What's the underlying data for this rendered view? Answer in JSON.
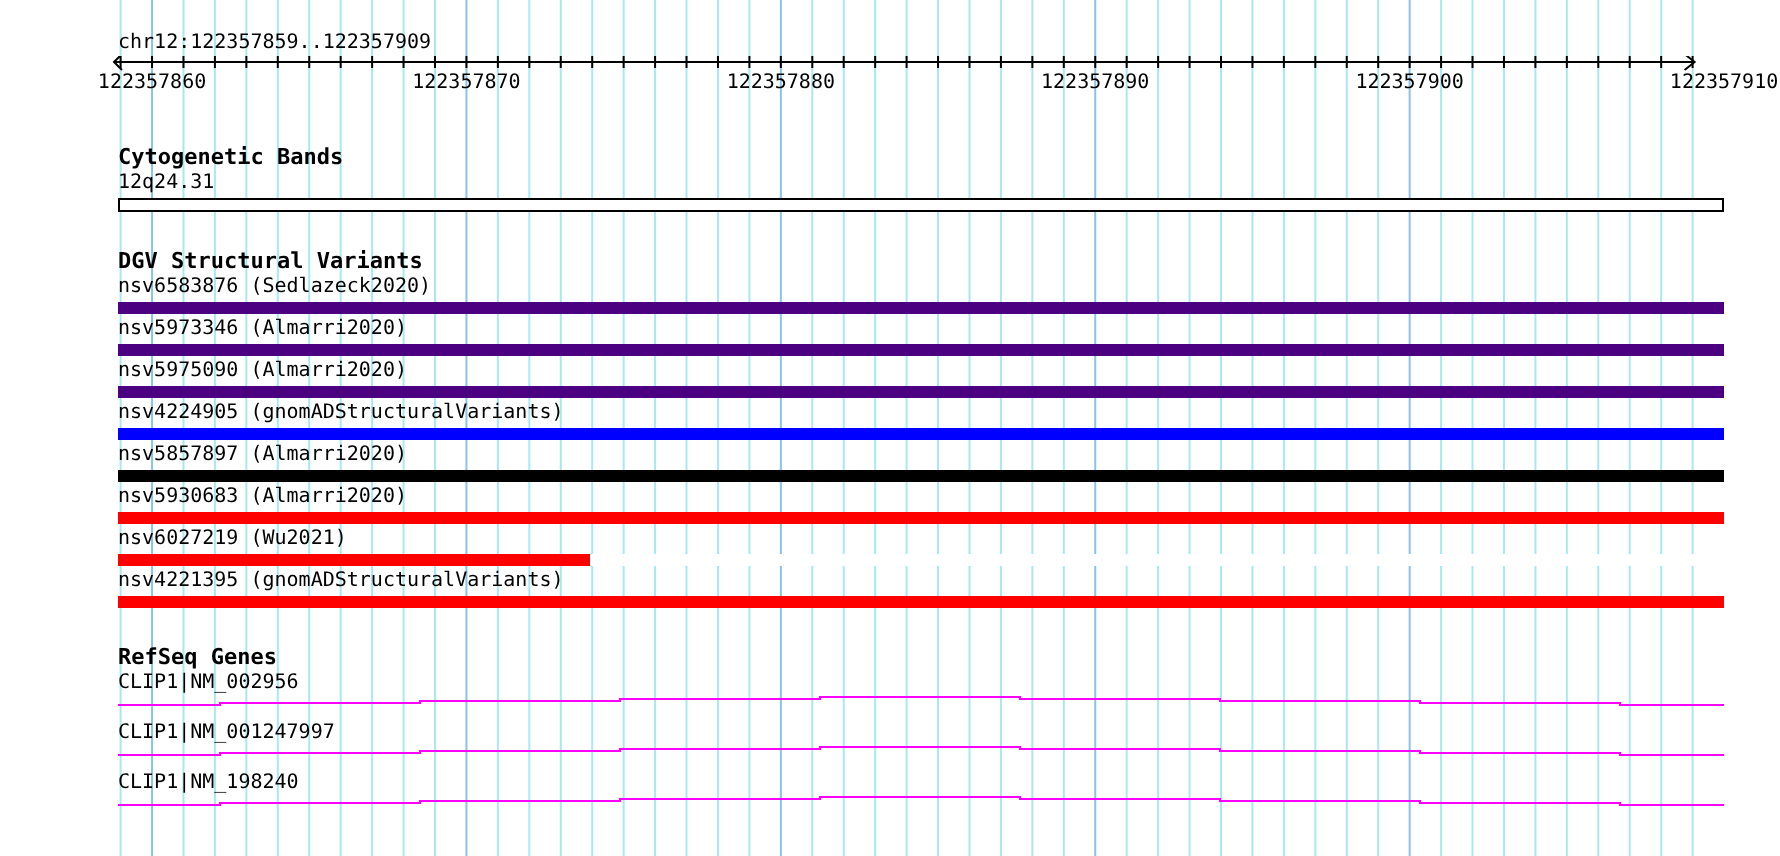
{
  "location": "chr12:122357859..122357909",
  "ruler": {
    "labels": [
      "122357860",
      "122357870",
      "122357880",
      "122357890",
      "122357900",
      "122357910"
    ]
  },
  "tracks": [
    {
      "kind": "cytoband",
      "title": "Cytogenetic Bands",
      "features": [
        {
          "label": "12q24.31"
        }
      ]
    },
    {
      "kind": "variants",
      "title": "DGV Structural Variants",
      "features": [
        {
          "label": "nsv6583876 (Sedlazeck2020)",
          "color": "#4b0082",
          "level": 1
        },
        {
          "label": "nsv5973346 (Almarri2020)",
          "color": "#4b0082",
          "level": 1
        },
        {
          "label": "nsv5975090 (Almarri2020)",
          "color": "#4b0082",
          "level": 1
        },
        {
          "label": "nsv4224905 (gnomADStructuralVariants)",
          "color": "#0000ff",
          "level": 1
        },
        {
          "label": "nsv5857897 (Almarri2020)",
          "color": "#000000",
          "level": 1
        },
        {
          "label": "nsv5930683 (Almarri2020)",
          "color": "#ff0000",
          "level": 1
        },
        {
          "label": "nsv6027219 (Wu2021)",
          "color": "#ff0000",
          "level": 0.294
        },
        {
          "label": "nsv4221395 (gnomADStructuralVariants)",
          "color": "#ff0000",
          "level": 1
        }
      ]
    },
    {
      "kind": "genes",
      "title": "RefSeq Genes",
      "features": [
        {
          "label": "CLIP1|NM_002956"
        },
        {
          "label": "CLIP1|NM_001247997"
        },
        {
          "label": "CLIP1|NM_198240"
        }
      ]
    }
  ]
}
